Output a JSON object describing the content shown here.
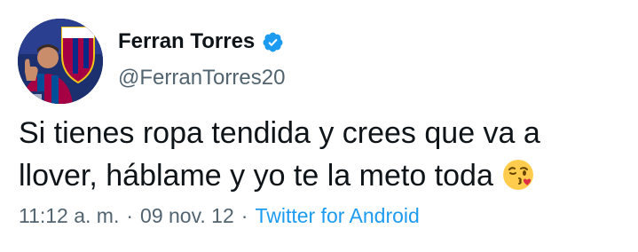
{
  "author": {
    "display_name": "Ferran Torres",
    "handle": "@FerranTorres20",
    "verified_icon": "verified-badge-icon",
    "avatar_icon": "fc-barcelona-avatar"
  },
  "tweet": {
    "line1": "Si tienes ropa tendida y crees que va a",
    "line2": "llover, háblame y yo te la meto toda",
    "emoji": "face-blowing-a-kiss-emoji"
  },
  "meta": {
    "time": "11:12 a. m.",
    "separator": "·",
    "date": "09 nov. 12",
    "source": "Twitter for Android"
  },
  "colors": {
    "text": "#0f1419",
    "secondary": "#536471",
    "link": "#1d9bf0",
    "verified": "#1d9bf0"
  }
}
